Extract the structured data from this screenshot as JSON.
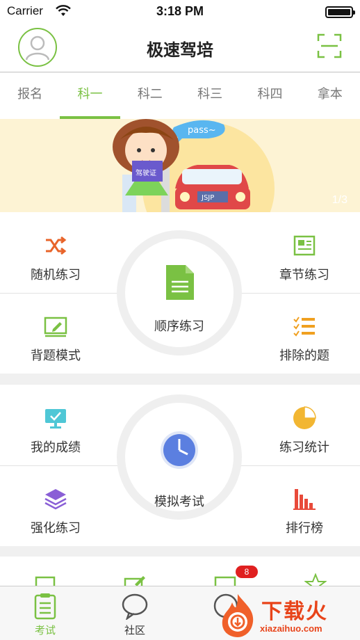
{
  "status_bar": {
    "carrier": "Carrier",
    "time": "3:18 PM"
  },
  "header": {
    "title": "极速驾培"
  },
  "tabs": [
    {
      "label": "报名",
      "active": false
    },
    {
      "label": "科一",
      "active": true
    },
    {
      "label": "科二",
      "active": false
    },
    {
      "label": "科三",
      "active": false
    },
    {
      "label": "科四",
      "active": false
    },
    {
      "label": "拿本",
      "active": false
    }
  ],
  "banner": {
    "speech_text": "pass~",
    "sign_text": "驾驶证",
    "plate_text": "JSJP",
    "indicator": "1/3"
  },
  "practice": {
    "random": "随机练习",
    "chapter": "章节练习",
    "sequential": "顺序练习",
    "memorize": "背题模式",
    "excluded": "排除的题"
  },
  "exam": {
    "my_scores": "我的成绩",
    "stats": "练习统计",
    "mock_exam": "模拟考试",
    "intensive": "强化练习",
    "ranking": "排行榜"
  },
  "partial": {
    "badge_count": "8"
  },
  "bottom_nav": {
    "exam": "考试",
    "community": "社区"
  },
  "watermark": {
    "text": "下载火",
    "url": "xiazaihuo.com"
  },
  "colors": {
    "accent": "#7ac143",
    "orange": "#f0a020",
    "purple": "#8a5fd6",
    "blue": "#5b7fe0",
    "red": "#e02020"
  }
}
